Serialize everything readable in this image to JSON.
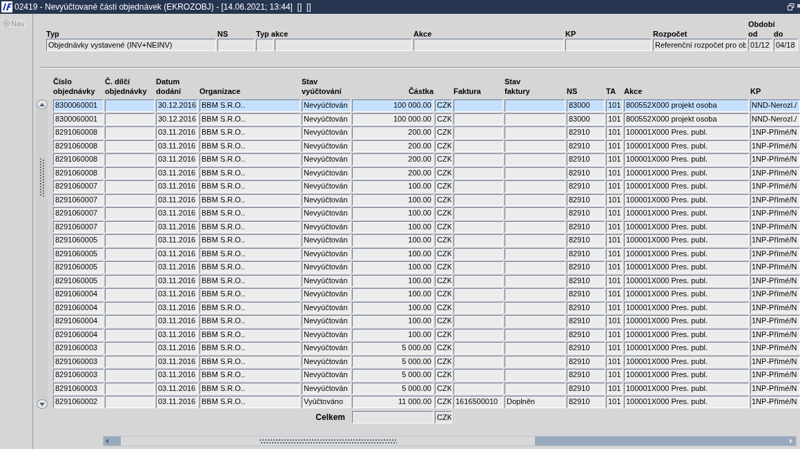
{
  "window": {
    "title": "02419 - Nevyúčtované části objednávek (EKROZOBJ) - [14.06.2021; 13:44]  []  []"
  },
  "nav": {
    "label": "Nav",
    "disabled": true
  },
  "filters": [
    {
      "kind": "labeled",
      "label": "Typ",
      "value": "Objednávky vystavené (INV+NEINV)"
    },
    {
      "kind": "labeled",
      "label": "NS"
    },
    {
      "kind": "labeled",
      "label": "Typ akce"
    },
    {
      "kind": "unlabeled"
    },
    {
      "kind": "labeled",
      "label": "Akce"
    },
    {
      "kind": "labeled",
      "label": "KP"
    },
    {
      "kind": "labeled",
      "label": "Rozpočet",
      "value": "Referenční rozpočet pro ob"
    },
    {
      "kind": "labeled",
      "label": "od",
      "value": "01/12"
    },
    {
      "kind": "labeled",
      "label": "do",
      "value": "04/18"
    }
  ],
  "period_label": "Období",
  "columns": [
    {
      "label": "Číslo\nobjednávky"
    },
    {
      "label": "Č. dílčí\nobjednávky"
    },
    {
      "label": "Datum\ndodání"
    },
    {
      "label": "Organizace"
    },
    {
      "label": "Stav\nvyúčtování"
    },
    {
      "label": "Částka"
    },
    {},
    {
      "label": "Faktura"
    },
    {
      "label": "Stav\nfaktury"
    },
    {
      "label": "NS"
    },
    {
      "label": "TA"
    },
    {
      "label": "Akce"
    },
    {
      "label": "KP"
    }
  ],
  "rows": [
    {
      "order_no": "8300060001",
      "date": "30.12.2016",
      "organization": "BBM S.R.O..",
      "status": "Nevyúčtován",
      "amount": "100 000.00",
      "currency": "CZK",
      "ns": "83000",
      "ta": "101",
      "action": "800552X000 projekt osoba",
      "kp": "NND-Nerozl./",
      "selected": true
    },
    {
      "order_no": "8300060001",
      "date": "30.12.2016",
      "organization": "BBM S.R.O..",
      "status": "Nevyúčtován",
      "amount": "100 000.00",
      "currency": "CZK",
      "ns": "83000",
      "ta": "101",
      "action": "800552X000 projekt osoba",
      "kp": "NND-Nerozl./",
      "selected": false
    },
    {
      "order_no": "8291060008",
      "date": "03.11.2016",
      "organization": "BBM S.R.O..",
      "status": "Nevyúčtován",
      "amount": "200.00",
      "currency": "CZK",
      "ns": "82910",
      "ta": "101",
      "action": "100001X000 Pres. publ.",
      "kp": "1NP-Přímé/N",
      "selected": false
    },
    {
      "order_no": "8291060008",
      "date": "03.11.2016",
      "organization": "BBM S.R.O..",
      "status": "Nevyúčtován",
      "amount": "200.00",
      "currency": "CZK",
      "ns": "82910",
      "ta": "101",
      "action": "100001X000 Pres. publ.",
      "kp": "1NP-Přímé/N",
      "selected": false
    },
    {
      "order_no": "8291060008",
      "date": "03.11.2016",
      "organization": "BBM S.R.O..",
      "status": "Nevyúčtován",
      "amount": "200.00",
      "currency": "CZK",
      "ns": "82910",
      "ta": "101",
      "action": "100001X000 Pres. publ.",
      "kp": "1NP-Přímé/N",
      "selected": false
    },
    {
      "order_no": "8291060008",
      "date": "03.11.2016",
      "organization": "BBM S.R.O..",
      "status": "Nevyúčtován",
      "amount": "200.00",
      "currency": "CZK",
      "ns": "82910",
      "ta": "101",
      "action": "100001X000 Pres. publ.",
      "kp": "1NP-Přímé/N",
      "selected": false
    },
    {
      "order_no": "8291060007",
      "date": "03.11.2016",
      "organization": "BBM S.R.O..",
      "status": "Nevyúčtován",
      "amount": "100.00",
      "currency": "CZK",
      "ns": "82910",
      "ta": "101",
      "action": "100001X000 Pres. publ.",
      "kp": "1NP-Přímé/N",
      "selected": false
    },
    {
      "order_no": "8291060007",
      "date": "03.11.2016",
      "organization": "BBM S.R.O..",
      "status": "Nevyúčtován",
      "amount": "100.00",
      "currency": "CZK",
      "ns": "82910",
      "ta": "101",
      "action": "100001X000 Pres. publ.",
      "kp": "1NP-Přímé/N",
      "selected": false
    },
    {
      "order_no": "8291060007",
      "date": "03.11.2016",
      "organization": "BBM S.R.O..",
      "status": "Nevyúčtován",
      "amount": "100.00",
      "currency": "CZK",
      "ns": "82910",
      "ta": "101",
      "action": "100001X000 Pres. publ.",
      "kp": "1NP-Přímé/N",
      "selected": false
    },
    {
      "order_no": "8291060007",
      "date": "03.11.2016",
      "organization": "BBM S.R.O..",
      "status": "Nevyúčtován",
      "amount": "100.00",
      "currency": "CZK",
      "ns": "82910",
      "ta": "101",
      "action": "100001X000 Pres. publ.",
      "kp": "1NP-Přímé/N",
      "selected": false
    },
    {
      "order_no": "8291060005",
      "date": "03.11.2016",
      "organization": "BBM S.R.O..",
      "status": "Nevyúčtován",
      "amount": "100.00",
      "currency": "CZK",
      "ns": "82910",
      "ta": "101",
      "action": "100001X000 Pres. publ.",
      "kp": "1NP-Přímé/N",
      "selected": false
    },
    {
      "order_no": "8291060005",
      "date": "03.11.2016",
      "organization": "BBM S.R.O..",
      "status": "Nevyúčtován",
      "amount": "100.00",
      "currency": "CZK",
      "ns": "82910",
      "ta": "101",
      "action": "100001X000 Pres. publ.",
      "kp": "1NP-Přímé/N",
      "selected": false
    },
    {
      "order_no": "8291060005",
      "date": "03.11.2016",
      "organization": "BBM S.R.O..",
      "status": "Nevyúčtován",
      "amount": "100.00",
      "currency": "CZK",
      "ns": "82910",
      "ta": "101",
      "action": "100001X000 Pres. publ.",
      "kp": "1NP-Přímé/N",
      "selected": false
    },
    {
      "order_no": "8291060005",
      "date": "03.11.2016",
      "organization": "BBM S.R.O..",
      "status": "Nevyúčtován",
      "amount": "100.00",
      "currency": "CZK",
      "ns": "82910",
      "ta": "101",
      "action": "100001X000 Pres. publ.",
      "kp": "1NP-Přímé/N",
      "selected": false
    },
    {
      "order_no": "8291060004",
      "date": "03.11.2016",
      "organization": "BBM S.R.O..",
      "status": "Nevyúčtován",
      "amount": "100.00",
      "currency": "CZK",
      "ns": "82910",
      "ta": "101",
      "action": "100001X000 Pres. publ.",
      "kp": "1NP-Přímé/N",
      "selected": false
    },
    {
      "order_no": "8291060004",
      "date": "03.11.2016",
      "organization": "BBM S.R.O..",
      "status": "Nevyúčtován",
      "amount": "100.00",
      "currency": "CZK",
      "ns": "82910",
      "ta": "101",
      "action": "100001X000 Pres. publ.",
      "kp": "1NP-Přímé/N",
      "selected": false
    },
    {
      "order_no": "8291060004",
      "date": "03.11.2016",
      "organization": "BBM S.R.O..",
      "status": "Nevyúčtován",
      "amount": "100.00",
      "currency": "CZK",
      "ns": "82910",
      "ta": "101",
      "action": "100001X000 Pres. publ.",
      "kp": "1NP-Přímé/N",
      "selected": false
    },
    {
      "order_no": "8291060004",
      "date": "03.11.2016",
      "organization": "BBM S.R.O..",
      "status": "Nevyúčtován",
      "amount": "100.00",
      "currency": "CZK",
      "ns": "82910",
      "ta": "101",
      "action": "100001X000 Pres. publ.",
      "kp": "1NP-Přímé/N",
      "selected": false
    },
    {
      "order_no": "8291060003",
      "date": "03.11.2016",
      "organization": "BBM S.R.O..",
      "status": "Nevyúčtován",
      "amount": "5 000.00",
      "currency": "CZK",
      "ns": "82910",
      "ta": "101",
      "action": "100001X000 Pres. publ.",
      "kp": "1NP-Přímé/N",
      "selected": false
    },
    {
      "order_no": "8291060003",
      "date": "03.11.2016",
      "organization": "BBM S.R.O..",
      "status": "Nevyúčtován",
      "amount": "5 000.00",
      "currency": "CZK",
      "ns": "82910",
      "ta": "101",
      "action": "100001X000 Pres. publ.",
      "kp": "1NP-Přímé/N",
      "selected": false
    },
    {
      "order_no": "8291060003",
      "date": "03.11.2016",
      "organization": "BBM S.R.O..",
      "status": "Nevyúčtován",
      "amount": "5 000.00",
      "currency": "CZK",
      "ns": "82910",
      "ta": "101",
      "action": "100001X000 Pres. publ.",
      "kp": "1NP-Přímé/N",
      "selected": false
    },
    {
      "order_no": "8291060003",
      "date": "03.11.2016",
      "organization": "BBM S.R.O..",
      "status": "Nevyúčtován",
      "amount": "5 000.00",
      "currency": "CZK",
      "ns": "82910",
      "ta": "101",
      "action": "100001X000 Pres. publ.",
      "kp": "1NP-Přímé/N",
      "selected": false
    },
    {
      "order_no": "8291060002",
      "date": "03.11.2016",
      "organization": "BBM S.R.O..",
      "status": "Vyúčtováno",
      "amount": "11 000.00",
      "currency": "CZK",
      "invoice": "1616500010",
      "invoice_status": "Doplněn",
      "ns": "82910",
      "ta": "101",
      "action": "100001X000 Pres. publ.",
      "kp": "1NP-Přímé/N",
      "selected": false
    }
  ],
  "total": {
    "label": "Celkem",
    "currency": "CZK"
  }
}
